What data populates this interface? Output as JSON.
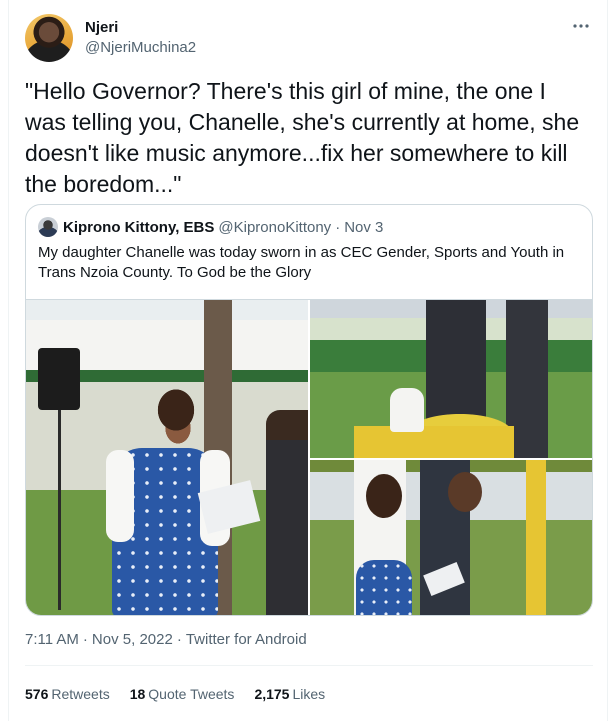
{
  "author": {
    "name": "Njeri",
    "handle": "@NjeriMuchina2"
  },
  "more_icon": "more-horizontal-icon",
  "tweet": {
    "text": "\"Hello Governor? There's this girl of mine, the one I was telling you, Chanelle, she's currently at home, she doesn't like music anymore...fix her somewhere to kill the boredom...\""
  },
  "quoted": {
    "name": "Kiprono Kittony, EBS",
    "handle": "@KipronoKittony",
    "separator": "·",
    "date": "Nov 3",
    "text": "My daughter Chanelle was today sworn in as CEC Gender, Sports and Youth in Trans Nzoia County. To God be the Glory"
  },
  "meta": {
    "time": "7:11 AM",
    "separator": "·",
    "date": "Nov 5, 2022",
    "source": "Twitter for Android"
  },
  "stats": {
    "retweets_count": "576",
    "retweets_label": "Retweets",
    "quotes_count": "18",
    "quotes_label": "Quote Tweets",
    "likes_count": "2,175",
    "likes_label": "Likes"
  },
  "colors": {
    "text_primary": "#0f1419",
    "text_secondary": "#536471",
    "border": "#cfd9de"
  }
}
